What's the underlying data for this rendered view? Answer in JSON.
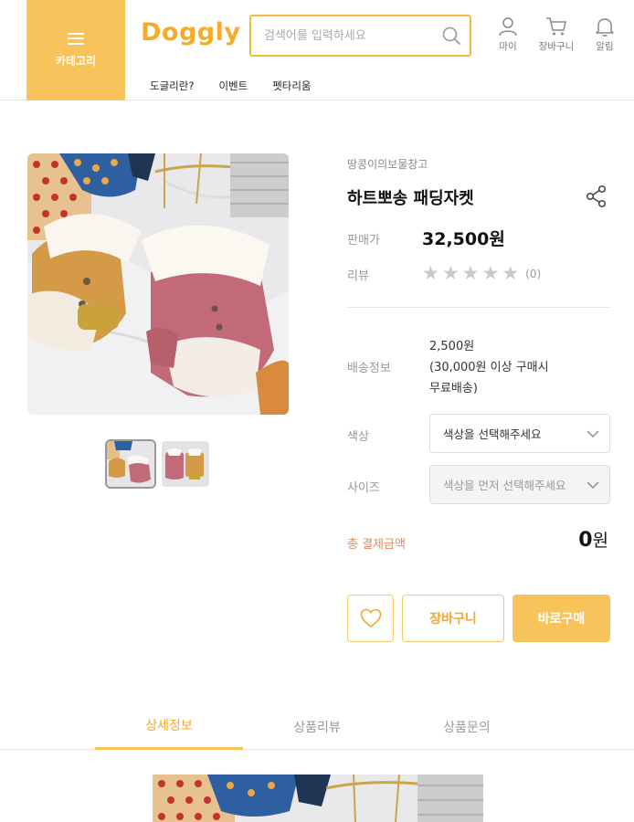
{
  "header": {
    "category_label": "카테고리",
    "logo": "Doggly",
    "search_placeholder": "검색어를 입력하세요",
    "icons": [
      {
        "name": "user-icon",
        "label": "마이"
      },
      {
        "name": "cart-icon",
        "label": "장바구니"
      },
      {
        "name": "bell-icon",
        "label": "알림"
      }
    ],
    "nav": [
      "도글리란?",
      "이벤트",
      "펫타리움"
    ]
  },
  "product": {
    "seller": "땅콩이의보물창고",
    "name": "하트뽀송 패딩자켓",
    "price_label": "판매가",
    "price": "32,500원",
    "review_label": "리뷰",
    "rating": 0,
    "review_count": "(0)",
    "shipping_label": "배송정보",
    "shipping_lines": [
      "2,500원",
      "(30,000원 이상 구매시",
      "무료배송)"
    ],
    "color_label": "색상",
    "color_select": "색상을 선택해주세요",
    "size_label": "사이즈",
    "size_select": "색상을 먼저 선택해주세요",
    "total_label": "총 결제금액",
    "total_value": "0",
    "total_unit": "원"
  },
  "actions": {
    "wishlist_icon": "heart-icon",
    "cart_label": "장바구니",
    "buy_label": "바로구매"
  },
  "tabs": [
    {
      "label": "상세정보",
      "active": true
    },
    {
      "label": "상품리뷰",
      "active": false
    },
    {
      "label": "상품문의",
      "active": false
    }
  ],
  "colors": {
    "accent": "#f8c35b",
    "accent_text": "#f0a92b",
    "total_label": "#f0845a"
  }
}
